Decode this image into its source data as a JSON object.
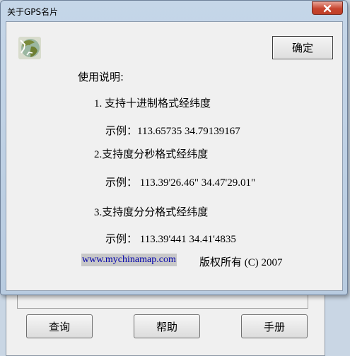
{
  "parent_window": {
    "buttons": {
      "query": "查询",
      "help": "帮助",
      "manual": "手册"
    }
  },
  "dialog": {
    "title": "关于GPS名片",
    "ok_label": "确定",
    "usage_heading": "使用说明:",
    "items": [
      {
        "text": "1. 支持十进制格式经纬度",
        "example": "示例：113.65735      34.79139167"
      },
      {
        "text": "2.支持度分秒格式经纬度",
        "example": "示例：  113.39'26.46\" 34.47'29.01\""
      },
      {
        "text": "3.支持度分分格式经纬度",
        "example": "示例：  113.39'441  34.41'4835"
      }
    ],
    "website": "www.mychinamap.com",
    "copyright": "版权所有 (C) 2007"
  },
  "icons": {
    "app": "globe-map-icon",
    "close": "close-icon"
  },
  "colors": {
    "frame": "#c5d6e8",
    "client_bg": "#f0f0f0",
    "close_red": "#c7442e",
    "link_blue": "#0000aa"
  }
}
